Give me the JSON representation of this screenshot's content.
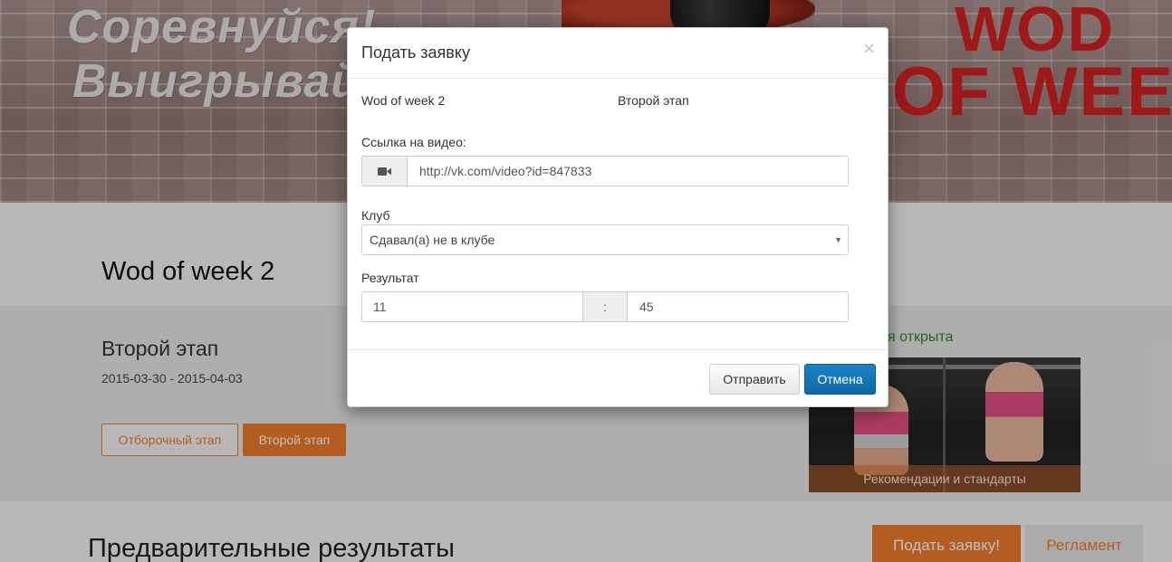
{
  "hero": {
    "slogan_line1": "Соревнуйся!",
    "slogan_line2": "Выигрывай!",
    "wod_line1": "WOD",
    "wod_line2": "OF WEEK"
  },
  "page": {
    "title": "Wod of week 2",
    "stage_title": "Второй этап",
    "stage_dates": "2015-03-30 - 2015-04-03",
    "stage_buttons": [
      "Отборочный этап",
      "Второй этап"
    ],
    "registration_status": "я открыта",
    "promo_caption": "Рекомендации и стандарты",
    "results_title": "Предварительные результаты",
    "apply_button": "Подать заявку!",
    "rules_button": "Регламент"
  },
  "modal": {
    "title": "Подать заявку",
    "close_label": "×",
    "wod_name": "Wod of week 2",
    "stage_name": "Второй этап",
    "video_label": "Ссылка на видео:",
    "video_value": "http://vk.com/video?id=847833",
    "video_icon": "video-camera-icon",
    "club_label": "Клуб",
    "club_selected": "Сдавал(а) не в клубе",
    "result_label": "Результат",
    "result_minutes": "11",
    "result_separator": ":",
    "result_seconds": "45",
    "submit_label": "Отправить",
    "cancel_label": "Отмена"
  },
  "colors": {
    "accent_orange": "#f07c2c",
    "primary_blue": "#1176b8",
    "status_green": "#2a8a2a",
    "wod_red": "#d81818"
  }
}
